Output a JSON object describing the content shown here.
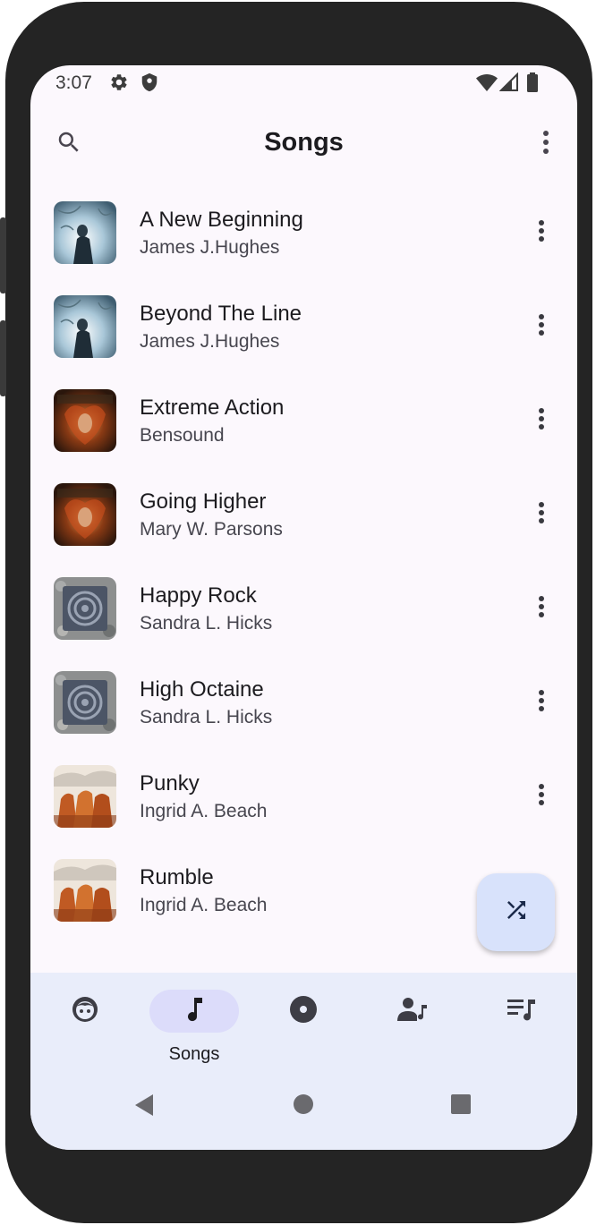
{
  "status_bar": {
    "time": "3:07",
    "left_icons": [
      "gear-icon",
      "shield-icon"
    ],
    "right_icons": [
      "wifi-icon",
      "signal-icon",
      "battery-icon"
    ]
  },
  "header": {
    "title": "Songs",
    "left_icon": "search-icon",
    "right_icon": "more-vert-icon"
  },
  "songs": [
    {
      "title": "A New Beginning",
      "artist": "James J.Hughes",
      "art": "winter-figure"
    },
    {
      "title": "Beyond The Line",
      "artist": "James J.Hughes",
      "art": "winter-figure"
    },
    {
      "title": "Extreme Action",
      "artist": "Bensound",
      "art": "rising-fire"
    },
    {
      "title": "Going Higher",
      "artist": "Mary W. Parsons",
      "art": "rising-fire"
    },
    {
      "title": "Happy Rock",
      "artist": "Sandra L. Hicks",
      "art": "stone-circle"
    },
    {
      "title": "High Octaine",
      "artist": "Sandra L. Hicks",
      "art": "stone-circle"
    },
    {
      "title": "Punky",
      "artist": "Ingrid A. Beach",
      "art": "horses"
    },
    {
      "title": "Rumble",
      "artist": "Ingrid A. Beach",
      "art": "horses"
    }
  ],
  "fab": {
    "icon": "shuffle-icon"
  },
  "bottom_nav": {
    "items": [
      {
        "icon": "face-icon",
        "label": "",
        "active": false
      },
      {
        "icon": "music-note-icon",
        "label": "Songs",
        "active": true
      },
      {
        "icon": "album-icon",
        "label": "",
        "active": false
      },
      {
        "icon": "artist-icon",
        "label": "",
        "active": false
      },
      {
        "icon": "playlist-icon",
        "label": "",
        "active": false
      }
    ]
  },
  "system_nav": {
    "icons": [
      "back-icon",
      "home-icon",
      "recents-icon"
    ]
  },
  "colors": {
    "frame": "#242424",
    "background": "#fcf8fd",
    "nav_background": "#e9edfa",
    "active_pill": "#dcdcfa",
    "fab": "#d8e2fb",
    "text_primary": "#1c1b1f",
    "text_secondary": "#47464f"
  }
}
